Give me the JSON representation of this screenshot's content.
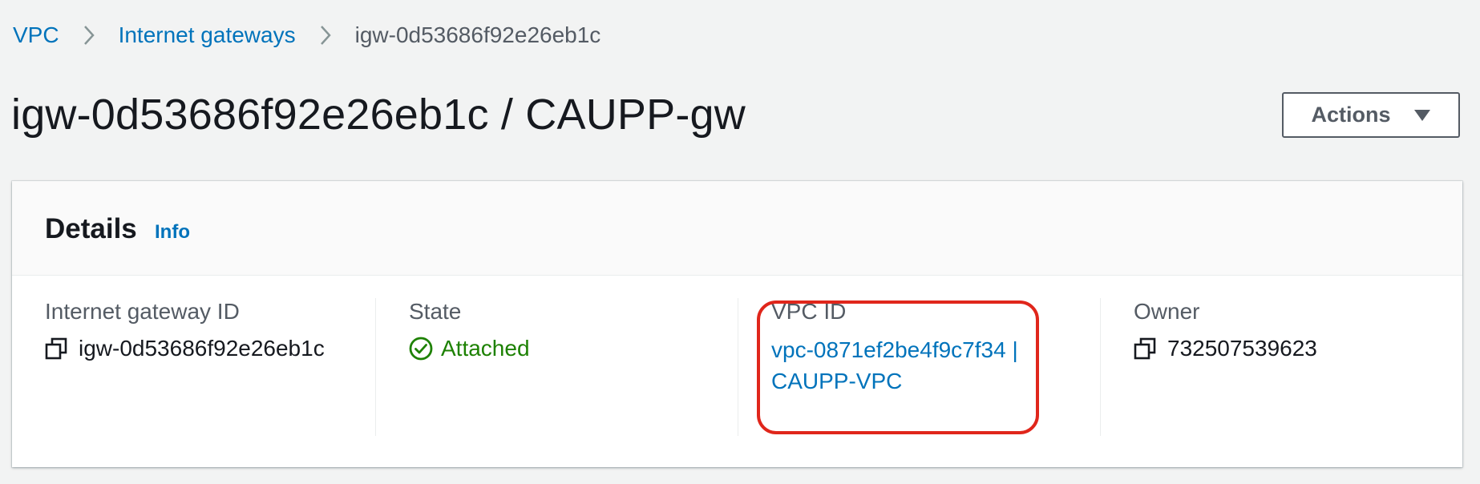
{
  "breadcrumb": {
    "items": [
      {
        "label": "VPC"
      },
      {
        "label": "Internet gateways"
      },
      {
        "label": "igw-0d53686f92e26eb1c"
      }
    ]
  },
  "page": {
    "title": "igw-0d53686f92e26eb1c / CAUPP-gw",
    "actions_label": "Actions"
  },
  "details": {
    "title": "Details",
    "info_label": "Info",
    "fields": {
      "gateway_id": {
        "label": "Internet gateway ID",
        "value": "igw-0d53686f92e26eb1c"
      },
      "state": {
        "label": "State",
        "value": "Attached"
      },
      "vpc_id": {
        "label": "VPC ID",
        "value_line1": "vpc-0871ef2be4f9c7f34 |",
        "value_line2": "CAUPP-VPC"
      },
      "owner": {
        "label": "Owner",
        "value": "732507539623"
      }
    }
  },
  "icons": {
    "breadcrumb_separator": "chevron-right-icon",
    "actions_caret": "caret-down-icon",
    "copy": "copy-icon",
    "state": "check-circle-icon"
  },
  "colors": {
    "link": "#0073bb",
    "success": "#1d8102",
    "highlight": "#e0261b",
    "background": "#f2f3f3"
  }
}
